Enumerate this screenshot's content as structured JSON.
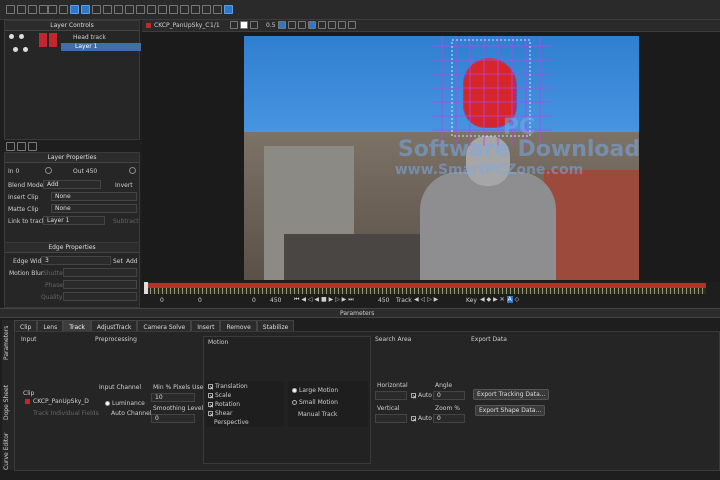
{
  "toolbar": {
    "clip_name": "CKCP_PanUpSky_C",
    "zoom": "1/1",
    "opacity": "0.5",
    "accent": "#2e78c7"
  },
  "layer_controls": {
    "title": "Layer Controls",
    "layers": [
      {
        "name": "Head track"
      },
      {
        "name": "Layer 1"
      }
    ]
  },
  "layer_properties": {
    "title": "Layer Properties",
    "in_label": "In 0",
    "out_label": "Out 450",
    "blend_mode_label": "Blend Mode",
    "blend_mode_value": "Add",
    "invert_label": "Invert",
    "insert_clip_label": "Insert Clip",
    "insert_clip_value": "None",
    "matte_clip_label": "Matte Clip",
    "matte_clip_value": "None",
    "link_label": "Link to track",
    "link_value": "Layer 1",
    "subtract_label": "Subtract"
  },
  "edge_properties": {
    "title": "Edge Properties",
    "edge_width_label": "Edge Width",
    "edge_width_value": "3",
    "set_label": "Set",
    "add_label": "Add",
    "motion_blur_label": "Motion Blur",
    "shutter_label": "Shutter",
    "phase_label": "Phase",
    "quality_label": "Quality"
  },
  "timeline": {
    "start": "0",
    "in": "0",
    "current": "0",
    "out": "450",
    "end": "450",
    "track_label": "Track",
    "key_label": "Key",
    "bar_color": "#b23227"
  },
  "parameters": {
    "title": "Parameters",
    "side_tabs": [
      "Parameters",
      "Dope Sheet",
      "Curve Editor"
    ],
    "tabs": [
      "Clip",
      "Lens",
      "Track",
      "AdjustTrack",
      "Camera Solve",
      "Insert",
      "Remove",
      "Stabilize"
    ],
    "active_tab": "Track",
    "input": {
      "title": "Input",
      "clip_label": "Clip",
      "clip_value": "CKCP_PanUpSky_D",
      "track_individual": "Track Individual Fields"
    },
    "preprocessing": {
      "title": "Preprocessing",
      "input_channel_label": "Input Channel",
      "luminance": "Luminance",
      "auto_channel": "Auto Channel",
      "min_pixels_label": "Min % Pixels Used",
      "min_pixels_value": "10",
      "smoothing_label": "Smoothing Level",
      "smoothing_value": "0"
    },
    "motion": {
      "title": "Motion",
      "translation": "Translation",
      "scale": "Scale",
      "rotation": "Rotation",
      "shear": "Shear",
      "perspective": "Perspective",
      "large_motion": "Large Motion",
      "small_motion": "Small Motion",
      "manual_track": "Manual Track"
    },
    "search_area": {
      "title": "Search Area",
      "horizontal_label": "Horizontal",
      "vertical_label": "Vertical",
      "auto_label": "Auto",
      "angle_label": "Angle",
      "angle_value": "0",
      "zoom_label": "Zoom %",
      "zoom_value": "0"
    },
    "export_data": {
      "title": "Export Data",
      "export_tracking": "Export Tracking Data...",
      "export_shape": "Export Shape Data..."
    }
  },
  "watermark": {
    "line1": "PC",
    "line2": "Software Download",
    "line3": "www.SmartPCZone.com"
  }
}
